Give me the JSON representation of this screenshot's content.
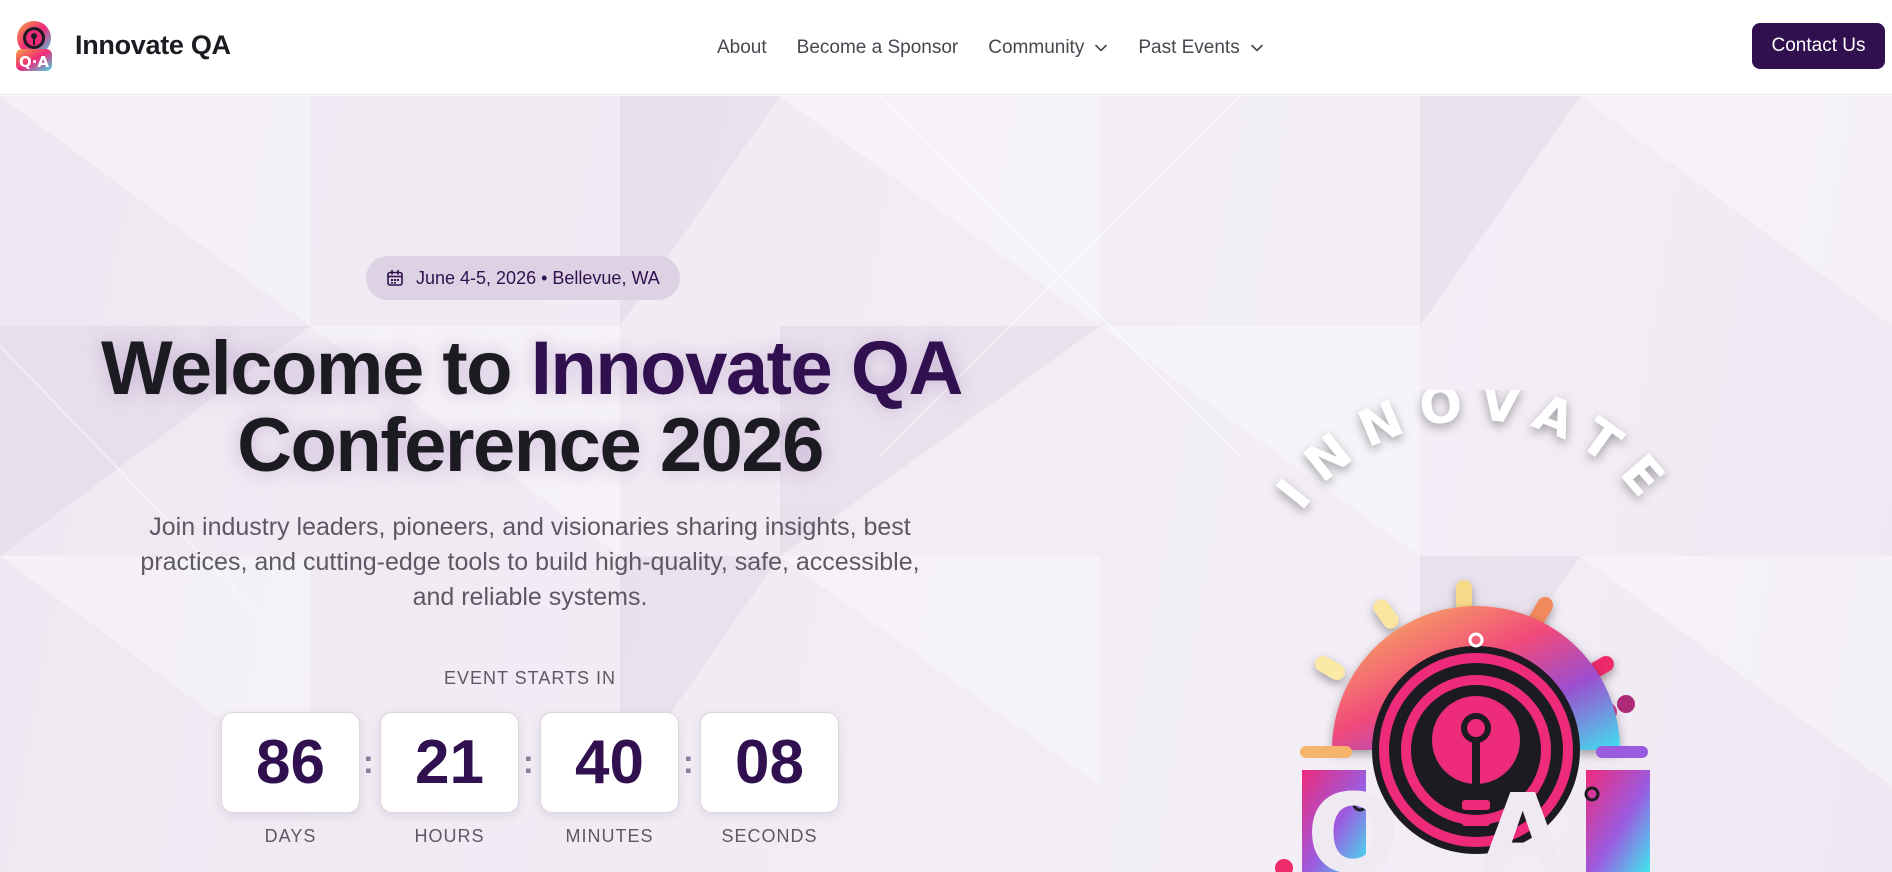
{
  "nav": {
    "brand": "Innovate QA",
    "logo_icon": "innovate-qa-logo",
    "links": [
      {
        "label": "About",
        "has_dropdown": false
      },
      {
        "label": "Become a Sponsor",
        "has_dropdown": false
      },
      {
        "label": "Community",
        "has_dropdown": true
      },
      {
        "label": "Past Events",
        "has_dropdown": true
      }
    ],
    "contact_label": "Contact Us"
  },
  "hero": {
    "date_icon": "calendar-icon",
    "date_location": "June 4-5, 2026 • Bellevue, WA",
    "title_part1": "Welcome to ",
    "title_accent": "Innovate QA",
    "title_part2": " Conference 2026",
    "subtitle": "Join industry leaders, pioneers, and visionaries sharing insights, best practices, and cutting-edge tools to build high-quality, safe, accessible, and reliable systems.",
    "countdown_label": "EVENT STARTS IN",
    "countdown": [
      {
        "value": "86",
        "unit": "DAYS"
      },
      {
        "value": "21",
        "unit": "HOURS"
      },
      {
        "value": "40",
        "unit": "MINUTES"
      },
      {
        "value": "08",
        "unit": "SECONDS"
      }
    ],
    "logo_arc_text": "INNOVATE",
    "logo_letters": "QA"
  },
  "colors": {
    "brand_dark": "#30104f",
    "text": "#1d1b22",
    "muted": "#5d5964",
    "pill": "#ddd2e3"
  }
}
